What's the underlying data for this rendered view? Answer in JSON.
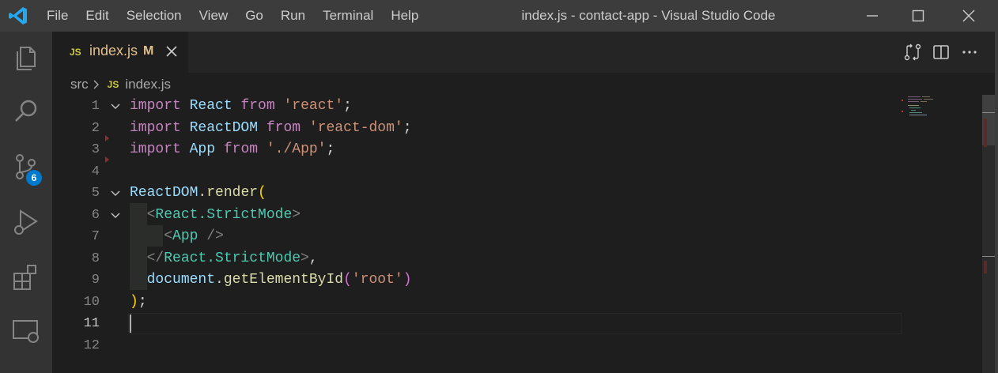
{
  "titlebar": {
    "menu": [
      "File",
      "Edit",
      "Selection",
      "View",
      "Go",
      "Run",
      "Terminal",
      "Help"
    ],
    "title": "index.js - contact-app - Visual Studio Code"
  },
  "activity": {
    "icons": [
      "explorer-icon",
      "search-icon",
      "source-control-icon",
      "run-debug-icon",
      "extensions-icon",
      "remote-explorer-icon"
    ],
    "scm_badge": "6"
  },
  "tab": {
    "icon": "JS",
    "name": "index.js",
    "modified": "M"
  },
  "breadcrumb": {
    "folder": "src",
    "icon": "JS",
    "file": "index.js"
  },
  "editor": {
    "line_numbers": [
      "1",
      "2",
      "3",
      "4",
      "5",
      "6",
      "7",
      "8",
      "9",
      "10",
      "11",
      "12"
    ],
    "active_line": "11"
  },
  "colors": {
    "accent": "#007acc",
    "keyword": "#c586c0",
    "string": "#ce9178",
    "tag": "#4ec9b0"
  }
}
